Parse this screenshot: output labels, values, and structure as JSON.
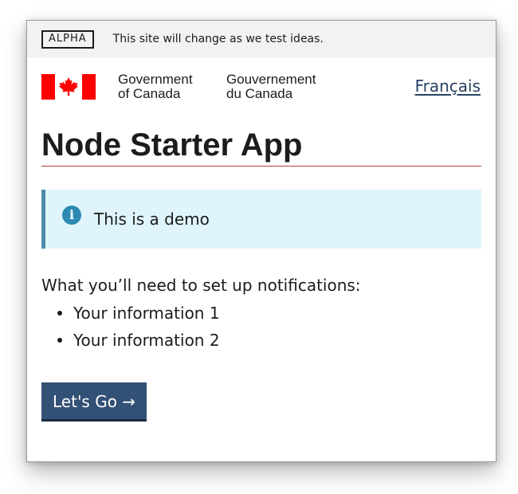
{
  "phase_banner": {
    "badge": "ALPHA",
    "text": "This site will change as we test ideas."
  },
  "header": {
    "signature_en": [
      "Government",
      "of Canada"
    ],
    "signature_fr": [
      "Gouvernement",
      "du Canada"
    ],
    "language_link": "Français",
    "flag_icon": "canada-flag-icon"
  },
  "main": {
    "title": "Node Starter App",
    "alert": {
      "icon": "info-icon",
      "icon_glyph": "i",
      "text": "This is a demo"
    },
    "needs_heading": "What you’ll need to set up notifications:",
    "needs_items": [
      "Your information 1",
      "Your information 2"
    ],
    "button_label": "Let's Go →"
  },
  "colors": {
    "banner_bg": "#f1f2f3",
    "title_rule": "#af3c43",
    "alert_bg": "#dff5fb",
    "alert_border": "#4e8ba9",
    "button_bg": "#335075",
    "link": "#284162",
    "flag_red": "#ff0000"
  }
}
